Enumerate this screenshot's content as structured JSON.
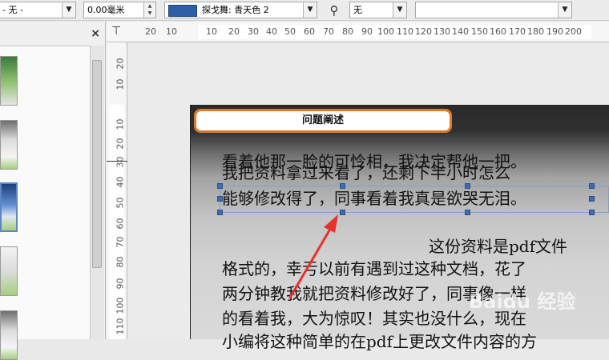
{
  "toolbar": {
    "line_style_value": "- 无 -",
    "line_width_value": "0.00毫米",
    "fill_color_label": "探戈舞: 青天色 2",
    "fill_color_hex": "#2e5ea8",
    "shadow_value": "无",
    "extra_value": ""
  },
  "left_panel": {
    "close_glyph": "×",
    "thumbnails": 6,
    "selected_thumbnail_index": 2
  },
  "ruler": {
    "h_labels": [
      "20",
      "10",
      "10",
      "20",
      "30",
      "40",
      "50",
      "60",
      "70",
      "80",
      "90",
      "100",
      "110",
      "120",
      "130",
      "140",
      "150",
      "160",
      "170",
      "180",
      "190",
      "200"
    ],
    "v_labels": [
      "20",
      "10",
      "10",
      "20",
      "30",
      "40",
      "50",
      "60",
      "70",
      "80",
      "90",
      "100",
      "110"
    ]
  },
  "slide": {
    "banner_title": "问题阐述",
    "overlap_line_a": "看着他那一脸的可怜相，我决定帮他一把。",
    "overlap_line_b": "我把资料拿过来看了，还剩下半小时怎么",
    "selected_line": "能够修改得了，同事看着我真是欲哭无泪。",
    "para_first_line": "这份资料是pdf文件",
    "para_lines": [
      "格式的，幸亏以前有遇到过这种文档，花了",
      "两分钟教我就把资料修改好了，同事像一样",
      "的看着我，大为惊叹！其实也没什么，现在"
    ],
    "partial_line": "小编将这种简单的在pdf上更改文件内容的方",
    "watermark": "Baidu 经验"
  },
  "colors": {
    "banner_border": "#e07a2a",
    "selection_handle": "#3c6db4",
    "arrow": "#e8322b"
  }
}
